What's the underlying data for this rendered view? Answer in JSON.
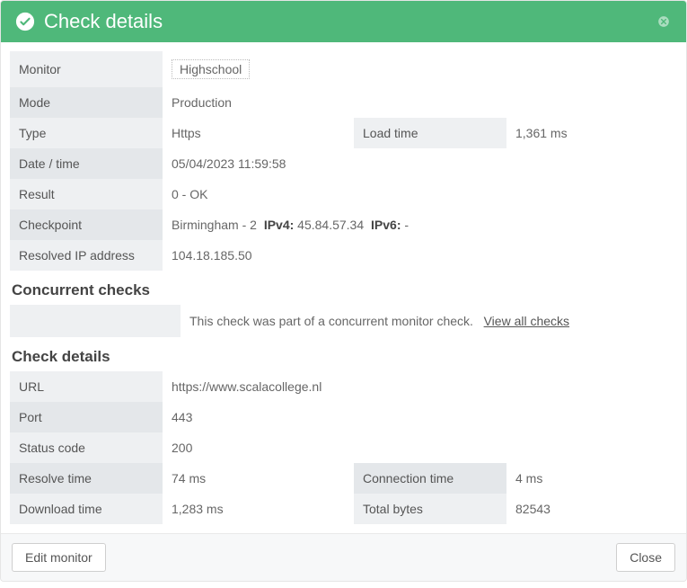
{
  "header": {
    "title": "Check details",
    "status_icon": "check-circle-icon",
    "close_icon": "close-icon"
  },
  "sections": {
    "monitor": {
      "label": "Monitor",
      "value": "Highschool"
    },
    "mode": {
      "label": "Mode",
      "value": "Production"
    },
    "type": {
      "label": "Type",
      "value": "Https"
    },
    "load_time": {
      "label": "Load time",
      "value": "1,361 ms"
    },
    "datetime": {
      "label": "Date / time",
      "value": "05/04/2023 11:59:58"
    },
    "result": {
      "label": "Result",
      "value": "0 - OK"
    },
    "checkpoint": {
      "label": "Checkpoint",
      "location": "Birmingham - 2",
      "ipv4_label": "IPv4:",
      "ipv4": "45.84.57.34",
      "ipv6_label": "IPv6:",
      "ipv6": "-"
    },
    "resolved_ip": {
      "label": "Resolved IP address",
      "value": "104.18.185.50"
    },
    "concurrent": {
      "title": "Concurrent checks",
      "text": "This check was part of a concurrent monitor check.",
      "link": "View all checks"
    },
    "check_details": {
      "title": "Check details",
      "url": {
        "label": "URL",
        "value": "https://www.scalacollege.nl"
      },
      "port": {
        "label": "Port",
        "value": "443"
      },
      "status_code": {
        "label": "Status code",
        "value": "200"
      },
      "resolve_time": {
        "label": "Resolve time",
        "value": "74 ms"
      },
      "conn_time": {
        "label": "Connection time",
        "value": "4 ms"
      },
      "dl_time": {
        "label": "Download time",
        "value": "1,283 ms"
      },
      "total_bytes": {
        "label": "Total bytes",
        "value": "82543"
      }
    }
  },
  "footer": {
    "edit_label": "Edit monitor",
    "close_label": "Close"
  }
}
